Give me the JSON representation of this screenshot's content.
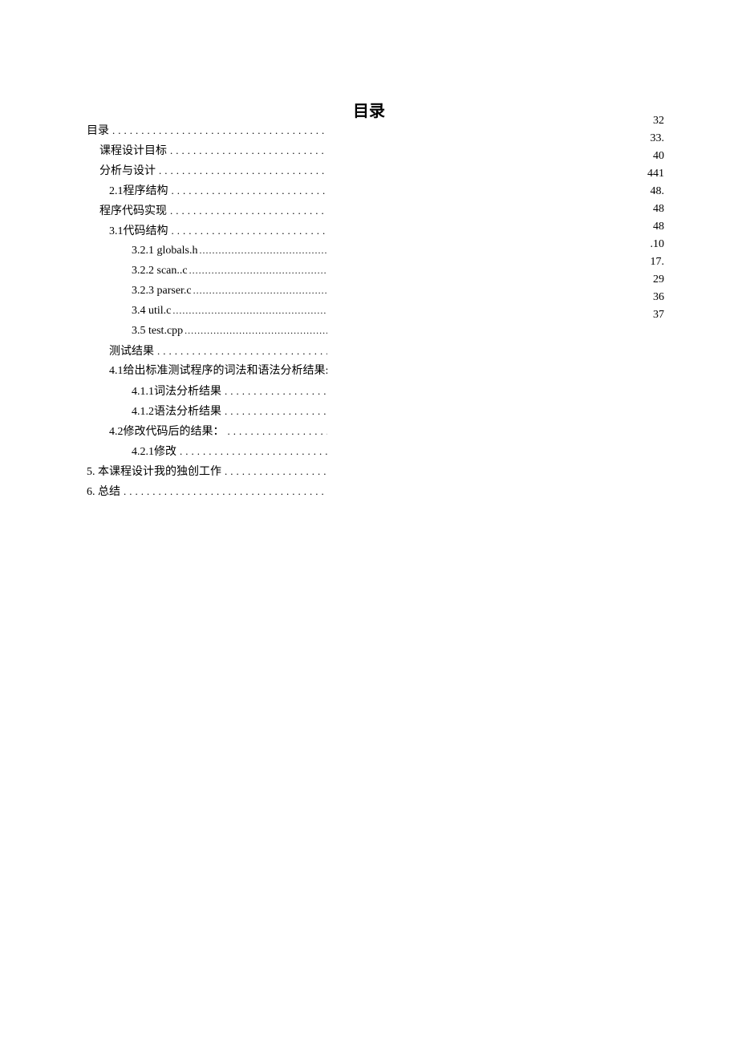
{
  "title": "目录",
  "toc": [
    {
      "label": "目录",
      "indent": 0,
      "dotStyle": "wide"
    },
    {
      "label": "课程设计目标",
      "indent": 1,
      "dotStyle": "wide"
    },
    {
      "label": "分析与设计",
      "indent": 1,
      "dotStyle": "wide"
    },
    {
      "label": "2.1程序结构",
      "indent": 2,
      "dotStyle": "wide"
    },
    {
      "label": "程序代码实现",
      "indent": 1,
      "dotStyle": "wide"
    },
    {
      "label": "3.1代码结构",
      "indent": 2,
      "dotStyle": "wide"
    },
    {
      "label": "3.2.1  globals.h",
      "indent": 3,
      "dotStyle": "tight"
    },
    {
      "label": "3.2.2  scan..c",
      "indent": 3,
      "dotStyle": "tight"
    },
    {
      "label": "3.2.3  parser.c",
      "indent": 3,
      "dotStyle": "tight"
    },
    {
      "label": "3.4  util.c",
      "indent": 3,
      "dotStyle": "tight"
    },
    {
      "label": "3.5  test.cpp",
      "indent": 3,
      "dotStyle": "tight"
    },
    {
      "label": "测试结果",
      "indent": 2,
      "dotStyle": "wide"
    },
    {
      "label": "4.1给出标准测试程序的词法和语法分析结果:",
      "indent": 2,
      "dotStyle": "none"
    },
    {
      "label": "4.1.1词法分析结果",
      "indent": 3,
      "dotStyle": "wide"
    },
    {
      "label": "4.1.2语法分析结果",
      "indent": 3,
      "dotStyle": "wide"
    },
    {
      "label": "4.2修改代码后的结果：",
      "indent": 2,
      "dotStyle": "wide"
    },
    {
      "label": "4.2.1修改",
      "indent": 3,
      "dotStyle": "wide"
    },
    {
      "label": "5.  本课程设计我的独创工作",
      "indent": 0,
      "dotStyle": "wide"
    },
    {
      "label": "6.  总结",
      "indent": 0,
      "dotStyle": "wide"
    }
  ],
  "pageNumbers": [
    "32",
    "33.",
    "40",
    "441",
    "48.",
    "48",
    "48",
    ".10",
    "17.",
    "29",
    "36",
    "37"
  ]
}
